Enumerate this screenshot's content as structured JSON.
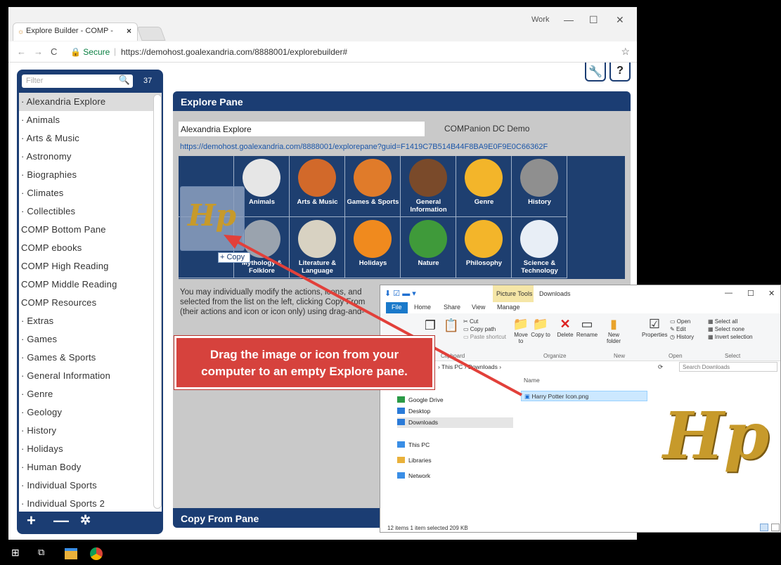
{
  "browser": {
    "tab_title": "Explore Builder - COMP -",
    "tab_close": "×",
    "profile": "Work",
    "minimize": "—",
    "maximize": "☐",
    "close": "✕",
    "secure_label": "Secure",
    "url": "https://demohost.goalexandria.com/8888001/explorebuilder#"
  },
  "sidebar": {
    "filter_placeholder": "Filter",
    "count": "37",
    "items": [
      "· Alexandria Explore",
      "· Animals",
      "· Arts & Music",
      "· Astronomy",
      "· Biographies",
      "· Climates",
      "· Collectibles",
      "COMP Bottom Pane",
      "COMP ebooks",
      "COMP High Reading",
      "COMP Middle Reading",
      "COMP Resources",
      "· Extras",
      "· Games",
      "· Games & Sports",
      "· General Information",
      "· Genre",
      "· Geology",
      "· History",
      "· Holidays",
      "· Human Body",
      "· Individual Sports",
      "· Individual Sports 2"
    ],
    "add": "+",
    "remove": "—",
    "settings": "✲"
  },
  "explore_pane": {
    "header": "Explore Pane",
    "name_value": "Alexandria Explore",
    "org": "COMPanion DC Demo",
    "link": "https://demohost.goalexandria.com/8888001/explorepane?guid=F1419C7B514B44F8BA9E0F9E0C66362F",
    "tiles_row1": [
      "",
      "Animals",
      "Arts & Music",
      "Games & Sports",
      "General Information",
      "Genre",
      "History"
    ],
    "tiles_row2": [
      "",
      "Mythology & Folklore",
      "Literature & Language",
      "Holidays",
      "Nature",
      "Philosophy",
      "Science & Technology"
    ],
    "text_line1": "You may individually modify the actions, icons, and",
    "text_line2": "selected from the list on the left, clicking Copy From",
    "text_line3": "(their actions and icon or icon only) using drag-and-",
    "copy_from_header": "Copy From Pane"
  },
  "drag": {
    "glyph": "Hp",
    "copy_label": "+ Copy"
  },
  "callout": {
    "line1": "Drag the image or icon from your",
    "line2": "computer to an empty Explore pane."
  },
  "explorer": {
    "picture_tools": "Picture Tools",
    "title": "Downloads",
    "tabs": [
      "File",
      "Home",
      "Share",
      "View",
      "Manage"
    ],
    "ribbon": {
      "cut": "Cut",
      "copy_path": "Copy path",
      "paste_shortcut": "Paste shortcut",
      "move_to": "Move to",
      "copy_to": "Copy to",
      "delete": "Delete",
      "rename": "Rename",
      "new_folder": "New folder",
      "properties": "Properties",
      "open": "Open",
      "edit": "Edit",
      "history": "History",
      "select_all": "Select all",
      "select_none": "Select none",
      "invert_selection": "Invert selection",
      "group_clipboard": "Clipboard",
      "group_organize": "Organize",
      "group_new": "New",
      "group_open": "Open",
      "group_select": "Select"
    },
    "breadcrumb": "› This PC › Downloads ›",
    "search_placeholder": "Search Downloads",
    "nav_items": [
      "Google Drive",
      "Desktop",
      "Downloads",
      "This PC",
      "Libraries",
      "Network"
    ],
    "column_name": "Name",
    "file_name": "Harry Potter Icon.png",
    "preview_glyph": "Hp",
    "status": "12 items    1 item selected  209 KB"
  }
}
